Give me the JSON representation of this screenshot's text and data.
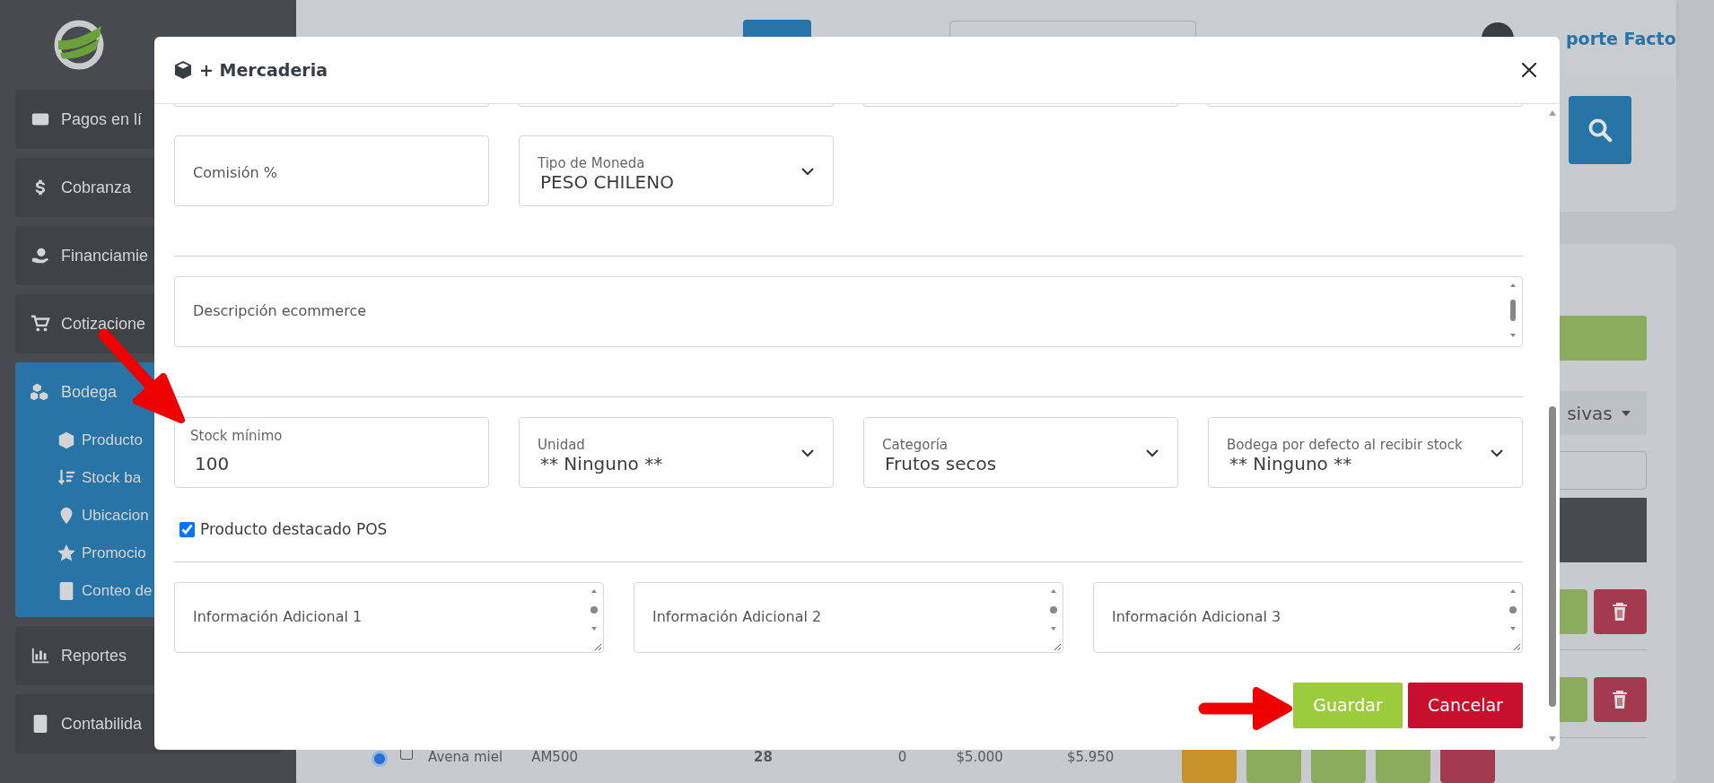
{
  "sidebar": {
    "items": [
      {
        "label": "Pagos en lí",
        "selected": false
      },
      {
        "label": "Cobranza",
        "selected": false
      },
      {
        "label": "Financiamie",
        "selected": false
      },
      {
        "label": "Cotizacione",
        "selected": false
      },
      {
        "label": "Bodega",
        "selected": true,
        "expanded": true,
        "children": [
          {
            "label": "Producto"
          },
          {
            "label": "Stock ba"
          },
          {
            "label": "Ubicacion"
          },
          {
            "label": "Promocio"
          },
          {
            "label": "Conteo de"
          }
        ]
      },
      {
        "label": "Reportes",
        "selected": false
      },
      {
        "label": "Contabilida",
        "selected": false
      }
    ]
  },
  "topbar": {
    "user_link": "porte Facto"
  },
  "filters": {
    "dropdown": "sivas"
  },
  "table": {
    "rows": [
      {
        "selected": true,
        "checked": false,
        "cells": [
          "Avena miel",
          "AM500",
          "28",
          "0",
          "$5.000",
          "$5.950"
        ]
      }
    ]
  },
  "modal": {
    "title": "+ Mercaderia",
    "sections": [
      {
        "fields": [
          {
            "kind": "cut"
          },
          {
            "kind": "cut"
          },
          {
            "kind": "cut"
          },
          {
            "kind": "cut"
          }
        ]
      },
      {
        "fields": [
          {
            "kind": "input",
            "placeholder": "Comisión %"
          },
          {
            "kind": "select",
            "label": "Tipo de Moneda",
            "value": "PESO CHILENO"
          }
        ]
      },
      {
        "fields": [
          {
            "kind": "textarea",
            "placeholder": "Descripción ecommerce"
          }
        ]
      },
      {
        "fields": [
          {
            "kind": "input",
            "label": "Stock mínimo",
            "value": "100"
          },
          {
            "kind": "select",
            "label": "Unidad",
            "value": "** Ninguno **"
          },
          {
            "kind": "select",
            "label": "Categoría",
            "value": "Frutos secos"
          },
          {
            "kind": "select",
            "label": "Bodega por defecto al recibir stock",
            "value": "** Ninguno **"
          }
        ]
      },
      {
        "fields": [
          {
            "kind": "checkbox",
            "label": "Producto destacado POS",
            "checked": true
          }
        ]
      },
      {
        "fields": [
          {
            "kind": "textarea",
            "placeholder": "Información Adicional 1",
            "resizable": true
          },
          {
            "kind": "textarea",
            "placeholder": "Información Adicional 2",
            "resizable": true
          },
          {
            "kind": "textarea",
            "placeholder": "Información Adicional 3",
            "resizable": true
          }
        ]
      }
    ],
    "buttons": [
      {
        "label": "Guardar",
        "kind": "save"
      },
      {
        "label": "Cancelar",
        "kind": "cancel"
      }
    ]
  }
}
